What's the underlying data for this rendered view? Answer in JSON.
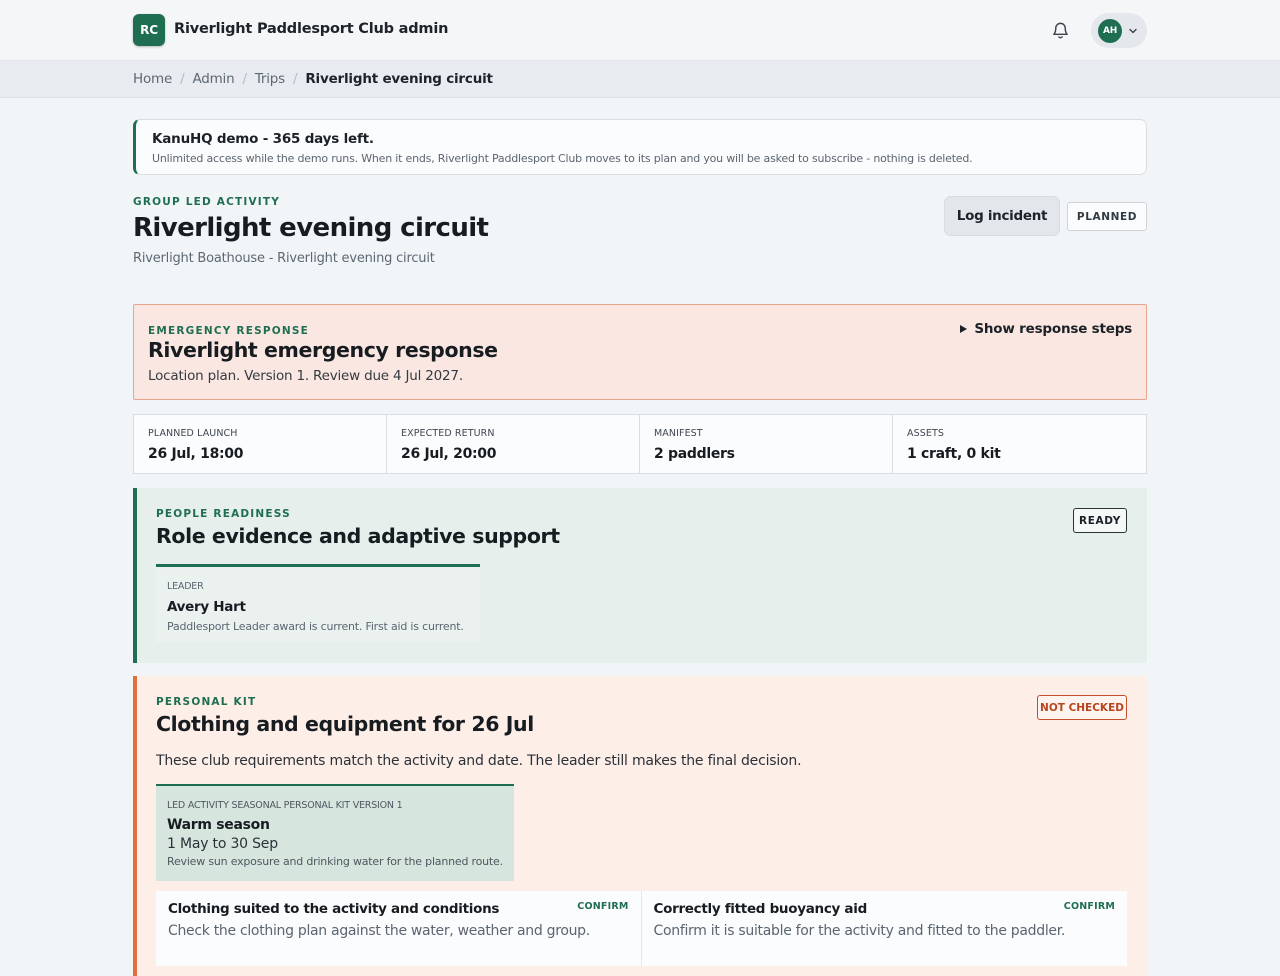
{
  "header": {
    "logo_initials": "RC",
    "app_title": "Riverlight Paddlesport Club admin",
    "user_initials": "AH"
  },
  "breadcrumb": [
    "Home",
    "Admin",
    "Trips",
    "Riverlight evening circuit"
  ],
  "banner": {
    "title": "KanuHQ demo - 365 days left.",
    "text": "Unlimited access while the demo runs. When it ends, Riverlight Paddlesport Club moves to its plan and you will be asked to subscribe - nothing is deleted."
  },
  "page": {
    "eyebrow": "GROUP LED ACTIVITY",
    "title": "Riverlight evening circuit",
    "subtitle": "Riverlight Boathouse - Riverlight evening circuit",
    "incident_button": "Log incident",
    "status": "PLANNED"
  },
  "emergency": {
    "eyebrow": "EMERGENCY RESPONSE",
    "title": "Riverlight emergency response",
    "text": "Location plan. Version 1. Review due 4 Jul 2027.",
    "toggle_label": "Show response steps"
  },
  "stats": [
    {
      "label": "PLANNED LAUNCH",
      "value": "26 Jul, 18:00"
    },
    {
      "label": "EXPECTED RETURN",
      "value": "26 Jul, 20:00"
    },
    {
      "label": "MANIFEST",
      "value": "2 paddlers"
    },
    {
      "label": "ASSETS",
      "value": "1 craft, 0 kit"
    }
  ],
  "people": {
    "eyebrow": "PEOPLE READINESS",
    "title": "Role evidence and adaptive support",
    "status": "READY",
    "role": {
      "label": "LEADER",
      "name": "Avery Hart",
      "note": "Paddlesport Leader award is current. First aid is current."
    }
  },
  "kit": {
    "eyebrow": "PERSONAL KIT",
    "title": "Clothing and equipment for 26 Jul",
    "status": "NOT CHECKED",
    "intro": "These club requirements match the activity and date. The leader still makes the final decision.",
    "season": {
      "label": "LED ACTIVITY SEASONAL PERSONAL KIT VERSION 1",
      "name": "Warm season",
      "range": "1 May to 30 Sep",
      "note": "Review sun exposure and drinking water for the planned route."
    },
    "items": [
      {
        "title": "Clothing suited to the activity and conditions",
        "text": "Check the clothing plan against the water, weather and group.",
        "status": "CONFIRM"
      },
      {
        "title": "Correctly fitted buoyancy aid",
        "text": "Confirm it is suitable for the activity and fitted to the paddler.",
        "status": "CONFIRM"
      }
    ]
  }
}
